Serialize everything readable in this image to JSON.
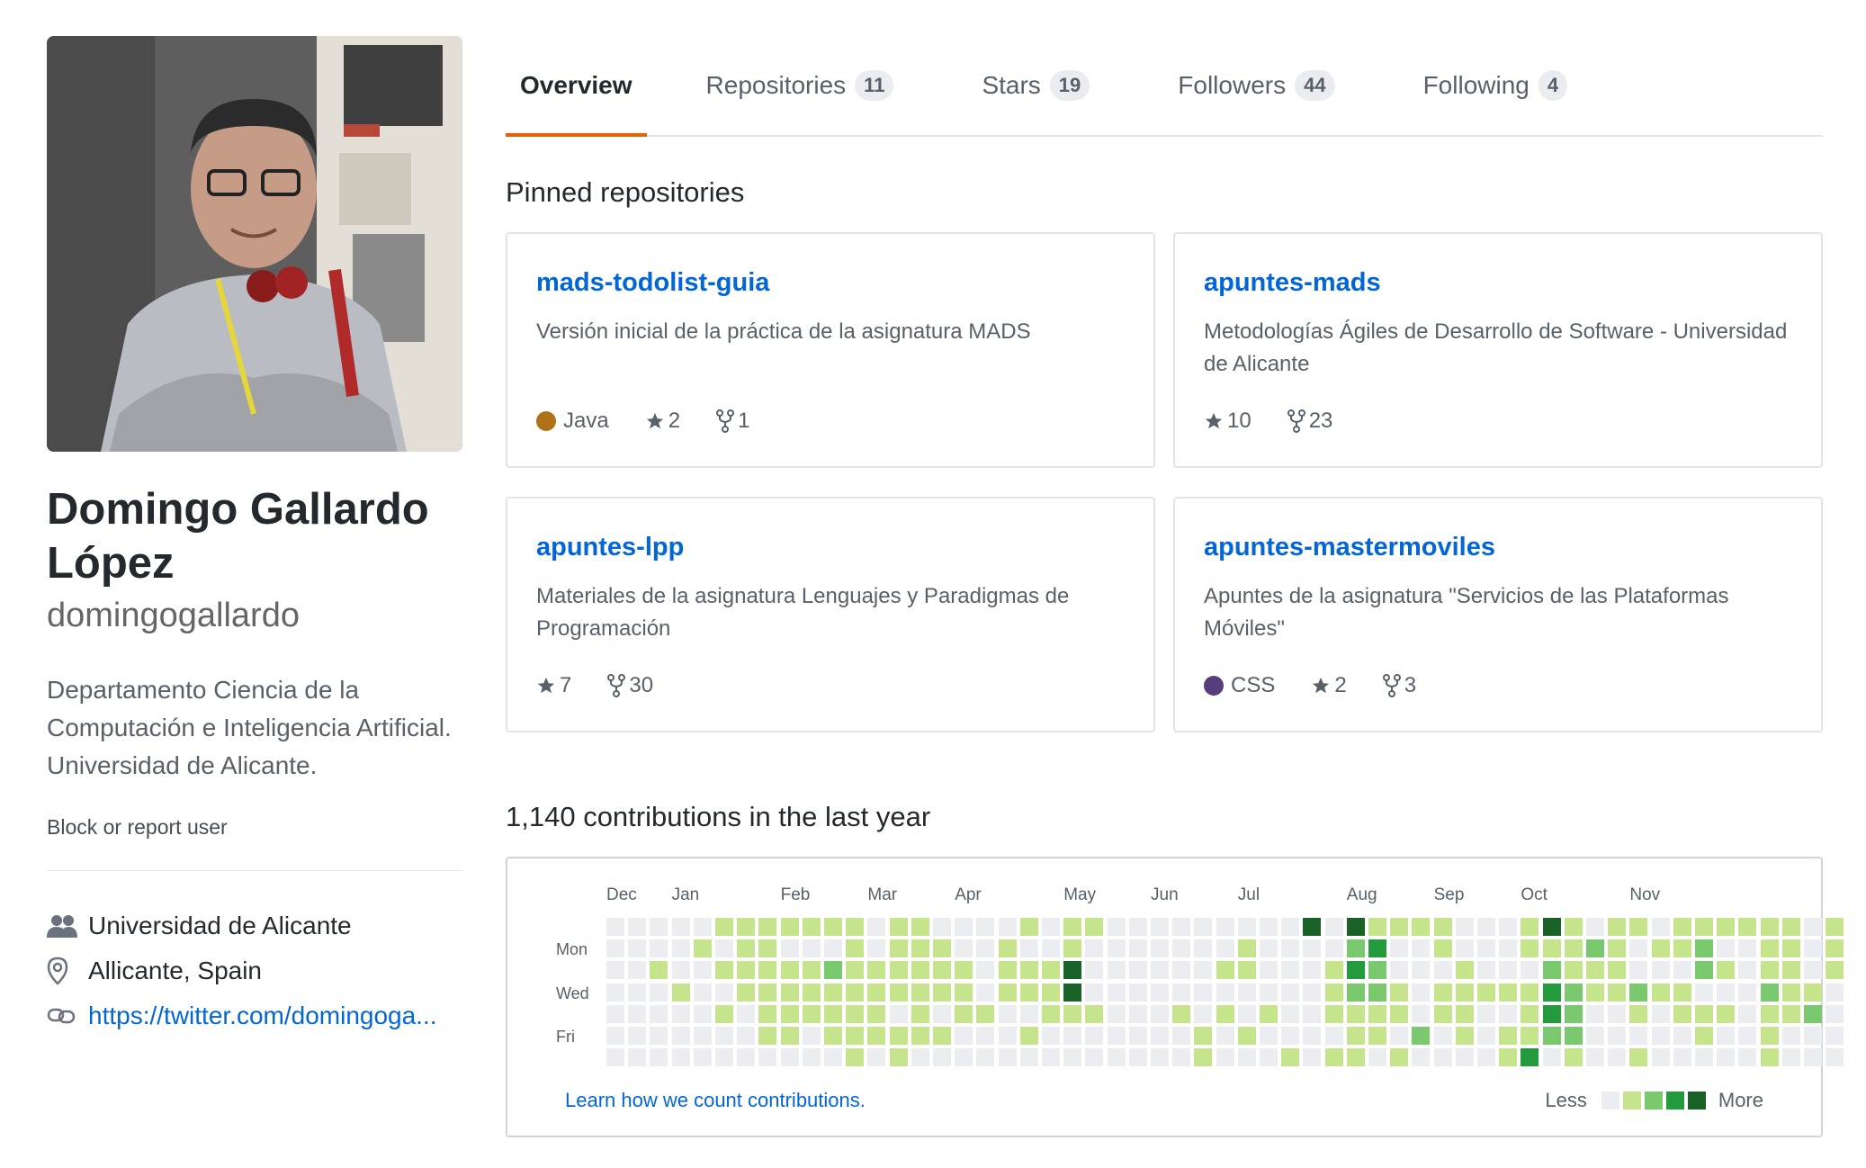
{
  "profile": {
    "full_name": "Domingo Gallardo López",
    "username": "domingogallardo",
    "bio": "Departamento Ciencia de la Computación e Inteligencia Artificial. Universidad de Alicante.",
    "block_label": "Block or report user",
    "organization": "Universidad de Alicante",
    "location": "Allicante, Spain",
    "website": "https://twitter.com/domingoga..."
  },
  "tabs": [
    {
      "label": "Overview",
      "count": null
    },
    {
      "label": "Repositories",
      "count": "11"
    },
    {
      "label": "Stars",
      "count": "19"
    },
    {
      "label": "Followers",
      "count": "44"
    },
    {
      "label": "Following",
      "count": "4"
    }
  ],
  "pinned": {
    "title": "Pinned repositories",
    "repos": [
      {
        "name": "mads-todolist-guia",
        "description": "Versión inicial de la práctica de la asignatura MADS",
        "language": "Java",
        "language_color": "#b07219",
        "stars": "2",
        "forks": "1"
      },
      {
        "name": "apuntes-mads",
        "description": "Metodologías Ágiles de Desarrollo de Software - Universidad de Alicante",
        "language": "",
        "language_color": "",
        "stars": "10",
        "forks": "23"
      },
      {
        "name": "apuntes-lpp",
        "description": "Materiales de la asignatura Lenguajes y Paradigmas de Programación",
        "language": "",
        "language_color": "",
        "stars": "7",
        "forks": "30"
      },
      {
        "name": "apuntes-mastermoviles",
        "description": "Apuntes de la asignatura \"Servicios de las Plataformas Móviles\"",
        "language": "CSS",
        "language_color": "#563d7c",
        "stars": "2",
        "forks": "3"
      }
    ]
  },
  "contributions": {
    "title": "1,140 contributions in the last year",
    "months": [
      "Dec",
      "Jan",
      "Feb",
      "Mar",
      "Apr",
      "May",
      "Jun",
      "Jul",
      "Aug",
      "Sep",
      "Oct",
      "Nov"
    ],
    "month_start_weeks": [
      0,
      3,
      8,
      12,
      16,
      21,
      25,
      29,
      34,
      38,
      42,
      47
    ],
    "days": [
      "Mon",
      "Wed",
      "Fri"
    ],
    "learn_label": "Learn how we count contributions.",
    "legend_less": "Less",
    "legend_more": "More",
    "colors": [
      "#ebedf0",
      "#c6e48b",
      "#7bc96f",
      "#239a3b",
      "#196127"
    ],
    "weeks": [
      "0000000",
      "0000000",
      "0010000",
      "0001000",
      "0100000",
      "1010100",
      "1111000",
      "1111110",
      "1011110",
      "1011100",
      "1021110",
      "1111111",
      "0011110",
      "1111011",
      "1111110",
      "0111010",
      "0011100",
      "0000100",
      "0111000",
      "1011010",
      "0011100",
      "1144100",
      "1000100",
      "0000000",
      "0000000",
      "0000000",
      "0000100",
      "0000011",
      "0010100",
      "0110010",
      "0000100",
      "0000001",
      "4000000",
      "0011101",
      "4232111",
      "1322110",
      "1001101",
      "1000020",
      "1101100",
      "0011110",
      "0001000",
      "0001011",
      "1101113",
      "4123320",
      "1112221",
      "0211000",
      "1111000",
      "1002101",
      "0101000",
      "1101100",
      "1220110",
      "1010100",
      "1000000",
      "1112111",
      "1111100",
      "0001200",
      "1110000"
    ]
  },
  "icons": {
    "org": "people-icon",
    "location": "location-pin-icon",
    "link": "link-icon",
    "star": "star-icon",
    "fork": "fork-icon"
  }
}
